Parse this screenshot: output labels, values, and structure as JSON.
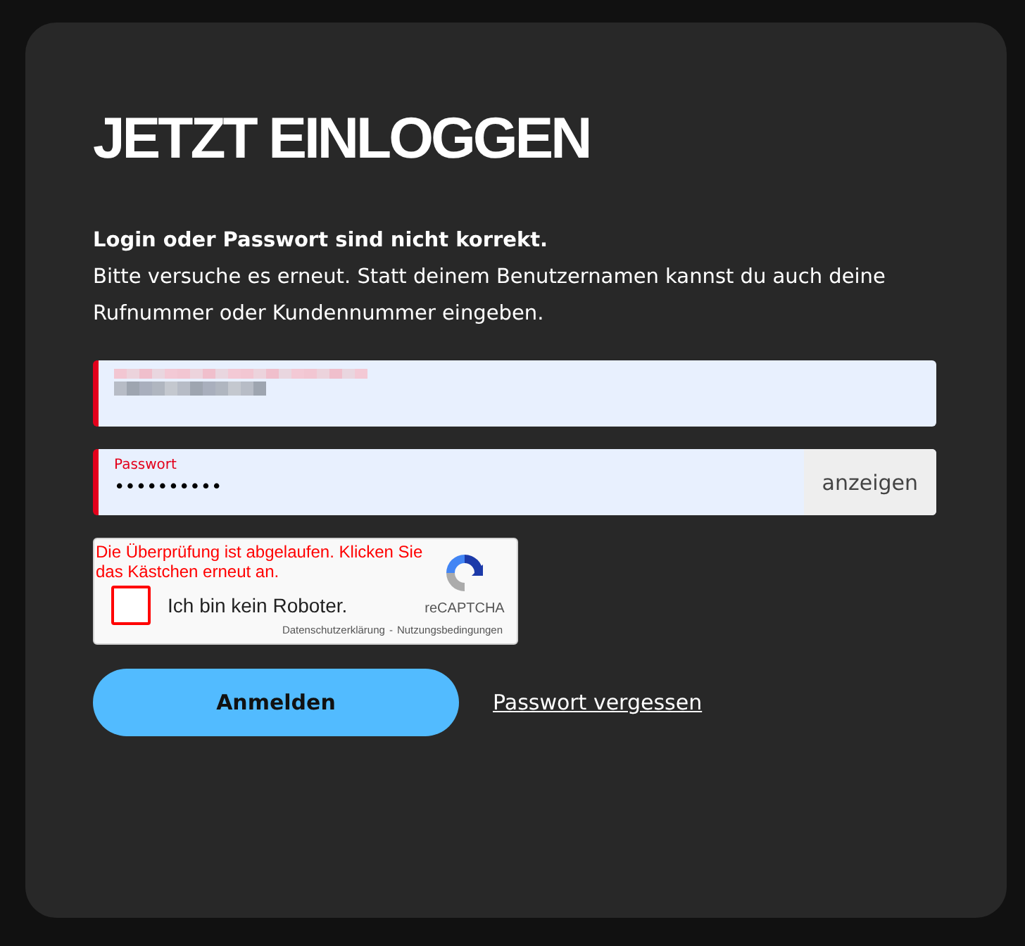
{
  "heading": "JETZT EINLOGGEN",
  "error": {
    "title": "Login oder Passwort sind nicht korrekt.",
    "message": "Bitte versuche es erneut. Statt deinem Benutzernamen kannst du auch deine Rufnummer oder Kundennummer eingeben."
  },
  "login_field": {
    "invalid": true
  },
  "password_field": {
    "label": "Passwort",
    "value": "••••••••••",
    "invalid": true,
    "toggle": "anzeigen"
  },
  "captcha": {
    "error": "Die Überprüfung ist abgelaufen. Klicken Sie das Kästchen erneut an.",
    "checked": false,
    "label": "Ich bin kein Roboter.",
    "brand": "reCAPTCHA",
    "links": [
      "Datenschutzerklärung",
      "Nutzungsbedingungen"
    ],
    "separator": "-"
  },
  "submit": "Anmelden",
  "forgot_link": "Passwort vergessen"
}
